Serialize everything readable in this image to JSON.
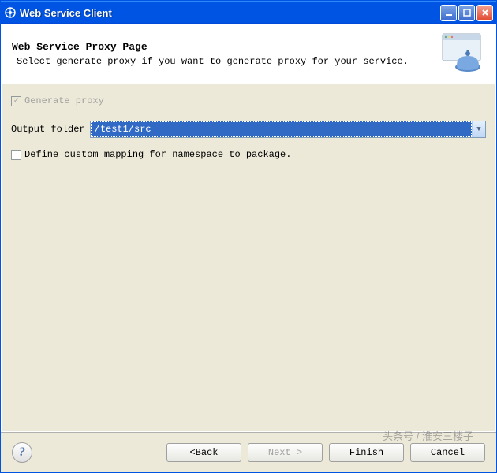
{
  "titlebar": {
    "title": "Web Service Client"
  },
  "header": {
    "title": "Web Service Proxy Page",
    "description": "Select generate proxy if you want to generate proxy for your service."
  },
  "form": {
    "generate_proxy_label": "Generate proxy",
    "generate_proxy_checked": true,
    "generate_proxy_enabled": false,
    "output_folder_label": "Output folder",
    "output_folder_value": "/test1/src",
    "define_mapping_label": "Define custom mapping for namespace to package.",
    "define_mapping_checked": false
  },
  "buttons": {
    "back": "< Back",
    "next": "Next >",
    "finish": "Finish",
    "cancel": "Cancel"
  },
  "watermark": "头条号 / 淮安三楼子"
}
